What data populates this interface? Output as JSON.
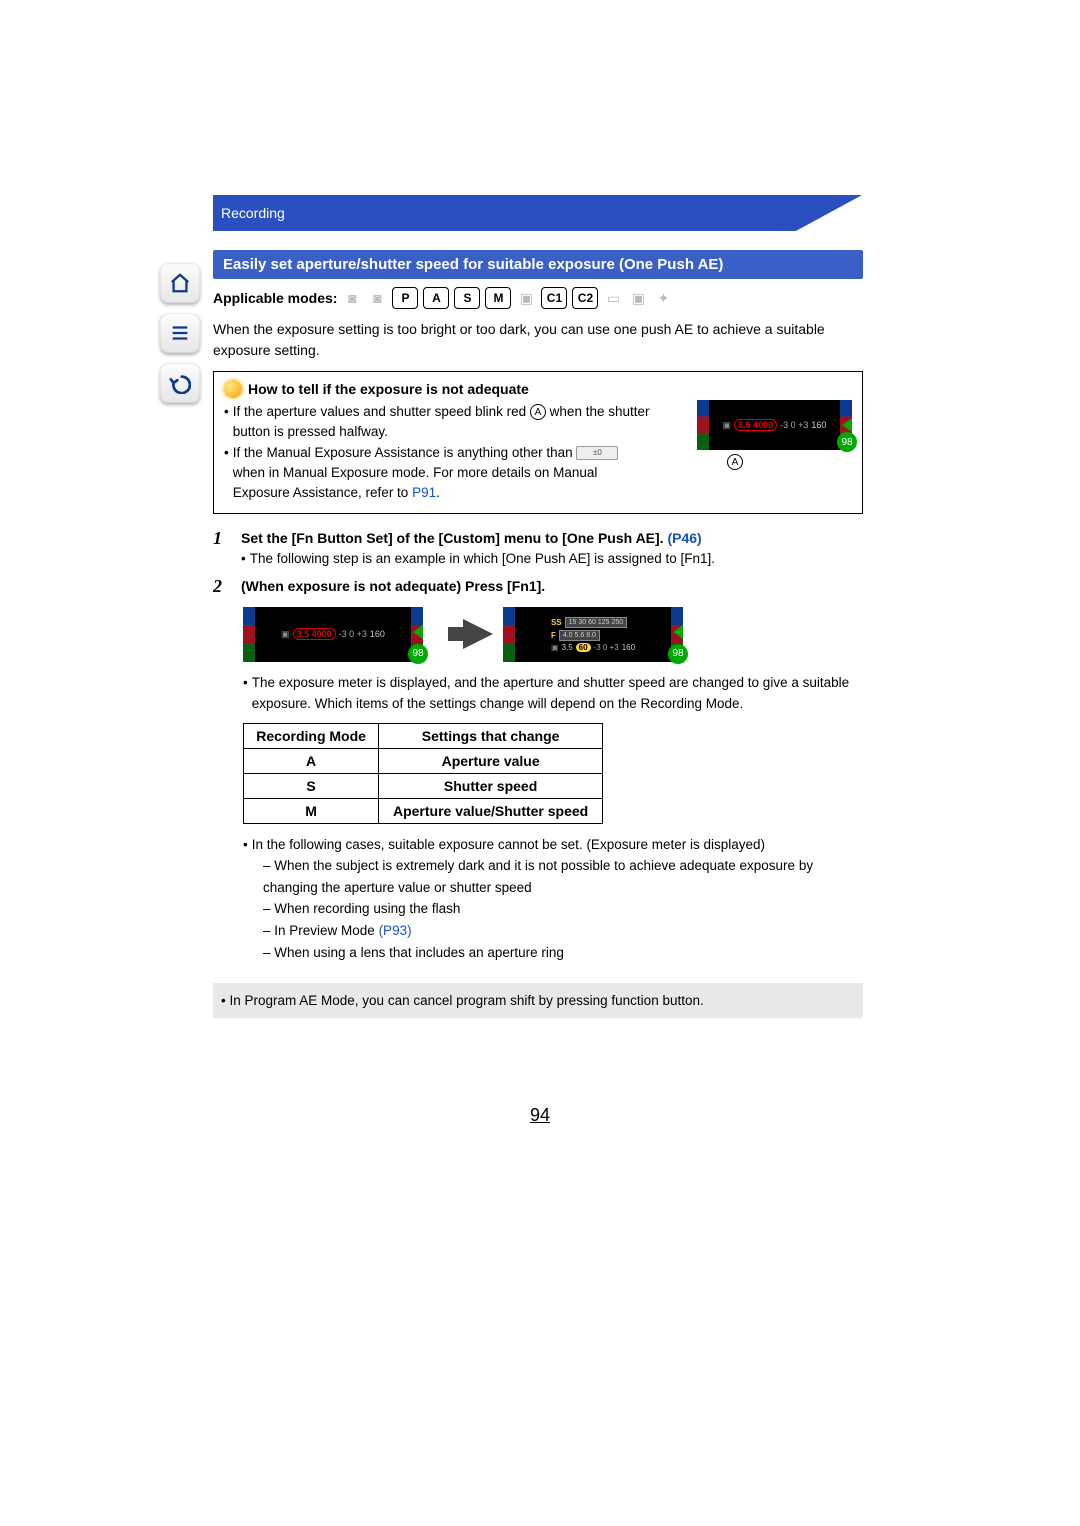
{
  "header": {
    "section": "Recording"
  },
  "nav": {
    "home_icon": "home-icon",
    "list_icon": "list-icon",
    "back_icon": "back-icon"
  },
  "title": "Easily set aperture/shutter speed for suitable exposure (One Push AE)",
  "applicable_label": "Applicable modes:",
  "intro": "When the exposure setting is too bright or too dark, you can use one push AE to achieve a suitable exposure setting.",
  "info_box": {
    "title": "How to tell if the exposure is not adequate",
    "line1a": "If the aperture values and shutter speed blink red ",
    "line1b": " when the shutter button is pressed halfway.",
    "line2a": "If the Manual Exposure Assistance is anything other than ",
    "line2b": " when in Manual Exposure mode. For more details on Manual Exposure Assistance, refer to ",
    "ev_text": "±0",
    "link": "P91",
    "period": "."
  },
  "lcd": {
    "aperture": "3.5",
    "shutter": "4000",
    "scale": "-3  0  +3",
    "iso": "160",
    "badge": "98",
    "marker": "A"
  },
  "step1": {
    "num": "1",
    "title_a": "Set the [Fn Button Set] of the [Custom] menu to [One Push AE]. ",
    "link": "(P46)",
    "sub": "The following step is an example in which [One Push AE] is assigned to [Fn1]."
  },
  "step2": {
    "num": "2",
    "title": "(When exposure is not adequate) Press [Fn1]."
  },
  "lcd_after": {
    "ss_label": "SS",
    "ss_scale": "15   30   60   125   250",
    "f_label": "F",
    "f_scale": "4.0   5.6   8.0",
    "aperture": "3.5",
    "shutter": "60",
    "scale": "-3  0  +3",
    "iso": "160",
    "badge": "98"
  },
  "after_text": "The exposure meter is displayed, and the aperture and shutter speed are changed to give a suitable exposure. Which items of the settings change will depend on the Recording Mode.",
  "table": {
    "h1": "Recording Mode",
    "h2": "Settings that change",
    "rows": [
      {
        "mode": "A",
        "change": "Aperture value"
      },
      {
        "mode": "S",
        "change": "Shutter speed"
      },
      {
        "mode": "M",
        "change": "Aperture value/Shutter speed"
      }
    ]
  },
  "exceptions": {
    "lead": "In the following cases, suitable exposure cannot be set. (Exposure meter is displayed)",
    "items": [
      "When the subject is extremely dark and it is not possible to achieve adequate exposure by changing the aperture value or shutter speed",
      "When recording using the flash",
      "In Preview Mode ",
      "When using a lens that includes an aperture ring"
    ],
    "preview_link": "(P93)"
  },
  "grey_note": "In Program AE Mode, you can cancel program shift by pressing function button.",
  "page_number": "94",
  "modes": {
    "p": "P",
    "a": "A",
    "s": "S",
    "m": "M",
    "c1": "C1",
    "c2": "C2"
  }
}
